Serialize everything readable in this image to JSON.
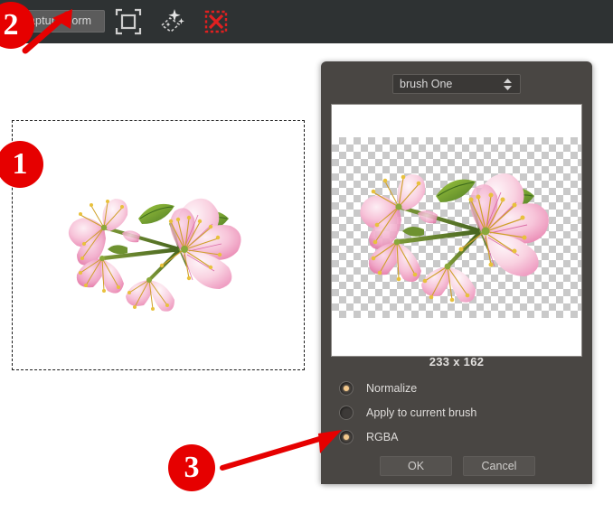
{
  "toolbar": {
    "capture_form_label": "Capture Form",
    "background_color": "#2e3233",
    "tools": [
      {
        "name": "capture-frame-icon",
        "tooltip": "Capture Frame"
      },
      {
        "name": "magic-select-icon",
        "tooltip": "Magic Select"
      },
      {
        "name": "deselect-icon",
        "tooltip": "Deselect",
        "color": "#e02020"
      }
    ]
  },
  "canvas": {
    "selection_border_style": "dashed",
    "artwork_name": "cherry-blossom-branch"
  },
  "dialog": {
    "background_color": "#494643",
    "brush_select": {
      "value": "brush One",
      "options": [
        "brush One"
      ]
    },
    "preview": {
      "size_label": "233 x 162",
      "artwork_name": "cherry-blossom-branch",
      "transparency_checker": true
    },
    "options": [
      {
        "label": "Normalize",
        "selected": true
      },
      {
        "label": "Apply to current brush",
        "selected": false
      },
      {
        "label": "RGBA",
        "selected": true
      }
    ],
    "buttons": {
      "ok_label": "OK",
      "cancel_label": "Cancel"
    }
  },
  "annotations": {
    "badges": [
      {
        "label": "1",
        "target": "canvas-selection"
      },
      {
        "label": "2",
        "target": "capture-form-button"
      },
      {
        "label": "3",
        "target": "radio-rgba"
      }
    ],
    "color": "#e60000"
  }
}
